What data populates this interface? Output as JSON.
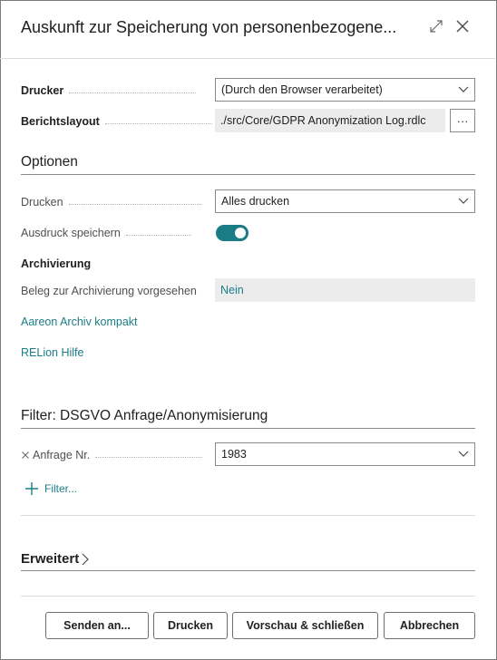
{
  "dialog": {
    "title": "Auskunft zur Speicherung von personenbezogene..."
  },
  "printer": {
    "label": "Drucker",
    "value": "(Durch den Browser verarbeitet)"
  },
  "report_layout": {
    "label": "Berichtslayout",
    "value": "./src/Core/GDPR Anonymization Log.rdlc",
    "more": "···"
  },
  "options": {
    "title": "Optionen",
    "print_label": "Drucken",
    "print_value": "Alles drucken",
    "save_label": "Ausdruck speichern",
    "save_on": true,
    "archive_heading": "Archivierung",
    "archive_label": "Beleg zur Archivierung vorgesehen",
    "archive_value": "Nein",
    "link_archiv": "Aareon Archiv kompakt",
    "link_help": "RELion Hilfe"
  },
  "filter": {
    "title": "Filter: DSGVO Anfrage/Anonymisierung",
    "field_label": "Anfrage Nr.",
    "field_value": "1983",
    "add_label": "Filter..."
  },
  "advanced": {
    "title": "Erweitert"
  },
  "buttons": {
    "send": "Senden an...",
    "print": "Drucken",
    "preview": "Vorschau & schließen",
    "cancel": "Abbrechen"
  }
}
